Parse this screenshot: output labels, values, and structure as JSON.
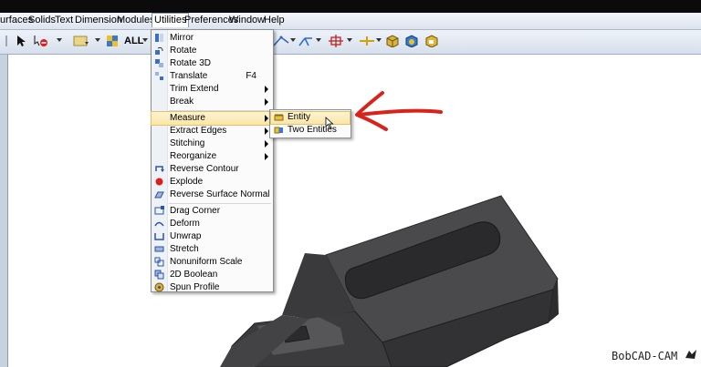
{
  "menubar": {
    "items": [
      "urfaces",
      "Solids",
      "Text",
      "Dimension",
      "Modules",
      "Utilities",
      "Preferences",
      "Window",
      "Help"
    ]
  },
  "toolbar": {
    "all_label": "ALL"
  },
  "utilities_menu": {
    "items": [
      {
        "label": "Mirror",
        "icon": "mirror-icon"
      },
      {
        "label": "Rotate",
        "icon": "rotate-icon"
      },
      {
        "label": "Rotate 3D",
        "icon": "rotate-3d-icon"
      },
      {
        "label": "Translate",
        "shortcut": "F4",
        "icon": "translate-icon"
      },
      {
        "label": "Trim Extend",
        "submenu": true
      },
      {
        "label": "Break",
        "submenu": true
      },
      {
        "label": "Measure",
        "submenu": true,
        "highlighted": true
      },
      {
        "label": "Extract Edges",
        "submenu": true
      },
      {
        "label": "Stitching",
        "submenu": true
      },
      {
        "label": "Reorganize",
        "submenu": true
      },
      {
        "label": "Reverse Contour",
        "icon": "reverse-contour-icon"
      },
      {
        "label": "Explode",
        "icon": "explode-icon"
      },
      {
        "label": "Reverse Surface Normal",
        "icon": "reverse-normal-icon"
      },
      {
        "label": "Drag Corner",
        "icon": "drag-corner-icon"
      },
      {
        "label": "Deform",
        "icon": "deform-icon"
      },
      {
        "label": "Unwrap",
        "icon": "unwrap-icon"
      },
      {
        "label": "Stretch",
        "icon": "stretch-icon"
      },
      {
        "label": "Nonuniform Scale",
        "icon": "nonuniform-scale-icon"
      },
      {
        "label": "2D Boolean",
        "icon": "boolean-icon"
      },
      {
        "label": "Spun Profile",
        "icon": "spun-profile-icon"
      }
    ]
  },
  "measure_submenu": {
    "items": [
      {
        "label": "Entity",
        "highlighted": true
      },
      {
        "label": "Two Entities"
      }
    ]
  },
  "watermark": {
    "brand": "BobCAD-CAM"
  },
  "colors": {
    "menu_highlight": "#f9e6a6",
    "annotation_arrow": "#d9221c",
    "part_gray": "#3d3d3f"
  }
}
